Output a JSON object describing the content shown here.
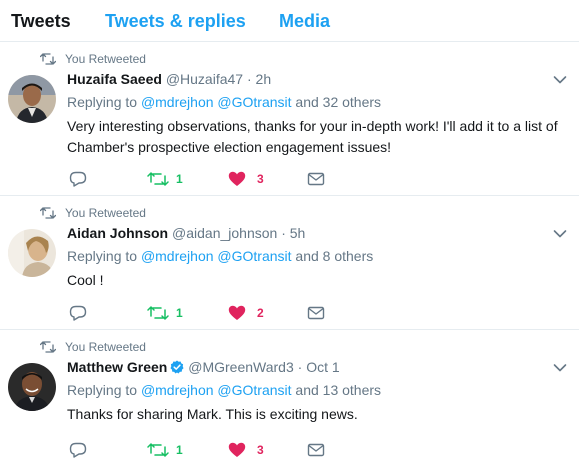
{
  "tabs": [
    {
      "label": "Tweets",
      "active": true
    },
    {
      "label": "Tweets & replies",
      "active": false
    },
    {
      "label": "Media",
      "active": false
    }
  ],
  "colors": {
    "link": "#1da1f2",
    "text": "#14171a",
    "secondary": "#657786",
    "retweet_green": "#17bf63",
    "like_red": "#e0245e",
    "divider": "#e6ecf0"
  },
  "tweets": [
    {
      "retweet_label": "You Retweeted",
      "name": "Huzaifa Saeed",
      "handle": "@Huzaifa47",
      "separator": "·",
      "time": "2h",
      "verified": false,
      "replying_prefix": "Replying to",
      "mention_1": "@mdrejhon",
      "mention_2": "@GOtransit",
      "replying_suffix": "and 32 others",
      "text": "Very interesting observations, thanks for your in-depth work! I'll add it to a list of Chamber's prospective election engagement issues!",
      "retweet_count": "1",
      "like_count": "3",
      "liked": true
    },
    {
      "retweet_label": "You Retweeted",
      "name": "Aidan Johnson",
      "handle": "@aidan_johnson",
      "separator": "·",
      "time": "5h",
      "verified": false,
      "replying_prefix": "Replying to",
      "mention_1": "@mdrejhon",
      "mention_2": "@GOtransit",
      "replying_suffix": "and 8 others",
      "text": "Cool !",
      "retweet_count": "1",
      "like_count": "2",
      "liked": true
    },
    {
      "retweet_label": "You Retweeted",
      "name": "Matthew Green",
      "handle": "@MGreenWard3",
      "separator": "·",
      "time": "Oct 1",
      "verified": true,
      "replying_prefix": "Replying to",
      "mention_1": "@mdrejhon",
      "mention_2": "@GOtransit",
      "replying_suffix": "and 13 others",
      "text": "Thanks for sharing Mark. This is exciting news.",
      "retweet_count": "1",
      "like_count": "3",
      "liked": true
    }
  ],
  "icons": {
    "retweeted_indicator": "retweet-icon",
    "caret": "chevron-down-icon",
    "reply": "reply-icon",
    "retweet": "retweet-icon",
    "like": "heart-icon",
    "dm": "envelope-icon",
    "verified": "verified-badge-icon"
  }
}
